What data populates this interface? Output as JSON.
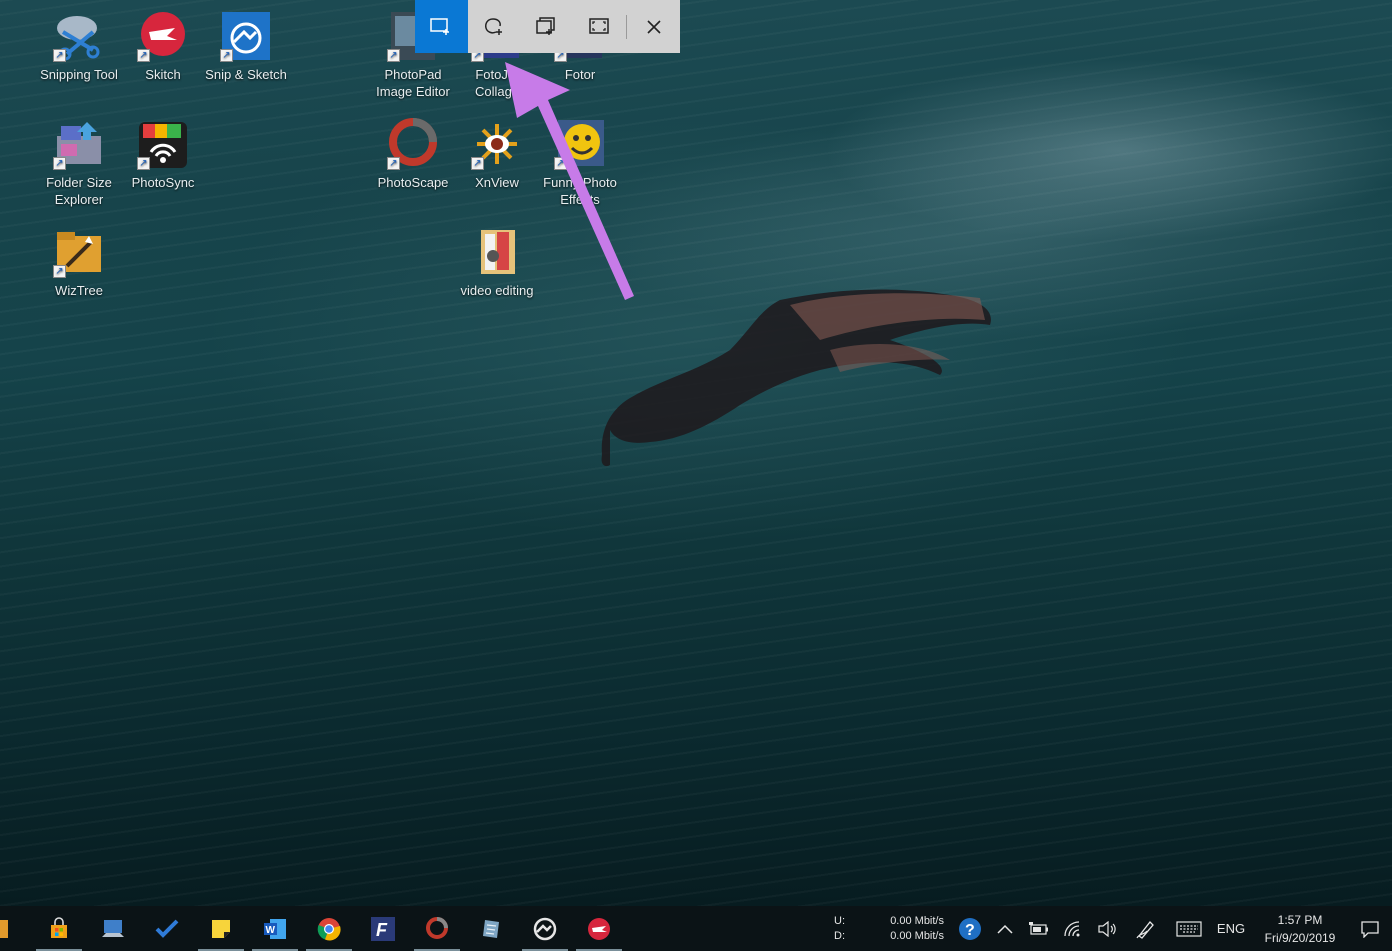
{
  "desktop_icons": [
    {
      "label": "Snipping Tool",
      "icon": "snipping-tool-icon"
    },
    {
      "label": "Skitch",
      "icon": "skitch-icon"
    },
    {
      "label": "Snip & Sketch",
      "icon": "snip-sketch-icon"
    },
    {
      "label": "PhotoPad Image Editor",
      "icon": "photopad-icon"
    },
    {
      "label": "FotoJet Collage",
      "icon": "fotojet-collage-icon"
    },
    {
      "label": "Fotor",
      "icon": "fotor-icon"
    },
    {
      "label": "Folder Size Explorer",
      "icon": "folder-size-explorer-icon"
    },
    {
      "label": "PhotoSync",
      "icon": "photosync-icon"
    },
    {
      "label": "PhotoScape",
      "icon": "photoscape-icon"
    },
    {
      "label": "XnView",
      "icon": "xnview-icon"
    },
    {
      "label": "Funny Photo Effects",
      "icon": "funny-photo-effects-icon"
    },
    {
      "label": "WizTree",
      "icon": "wiztree-icon"
    },
    {
      "label": "video editing",
      "icon": "folder-icon"
    }
  ],
  "snip_toolbar": {
    "modes": [
      {
        "icon": "rectangular-snip-icon",
        "active": true
      },
      {
        "icon": "freeform-snip-icon",
        "active": false
      },
      {
        "icon": "window-snip-icon",
        "active": false
      },
      {
        "icon": "fullscreen-snip-icon",
        "active": false
      }
    ],
    "close_icon": "close-icon",
    "active_color": "#0a78d4"
  },
  "annotation": {
    "arrow_color": "#c77be8"
  },
  "taskbar": {
    "apps": [
      "microsoft-store-icon",
      "remote-desktop-icon",
      "todo-icon",
      "sticky-notes-icon",
      "word-icon",
      "chrome-icon",
      "fotor-f-icon",
      "photoscape-icon",
      "notepad-icon",
      "snip-sketch-icon",
      "skitch-icon"
    ],
    "net_speed": {
      "up_label": "U:",
      "up_value": "0.00 Mbit/s",
      "down_label": "D:",
      "down_value": "0.00 Mbit/s"
    },
    "tray_icons": [
      "help-icon",
      "chevron-up-icon",
      "battery-icon",
      "wifi-icon",
      "volume-icon",
      "pen-icon",
      "keyboard-icon"
    ],
    "language": "ENG",
    "time": "1:57 PM",
    "date": "Fri/9/20/2019",
    "notification_icon": "action-center-icon"
  }
}
